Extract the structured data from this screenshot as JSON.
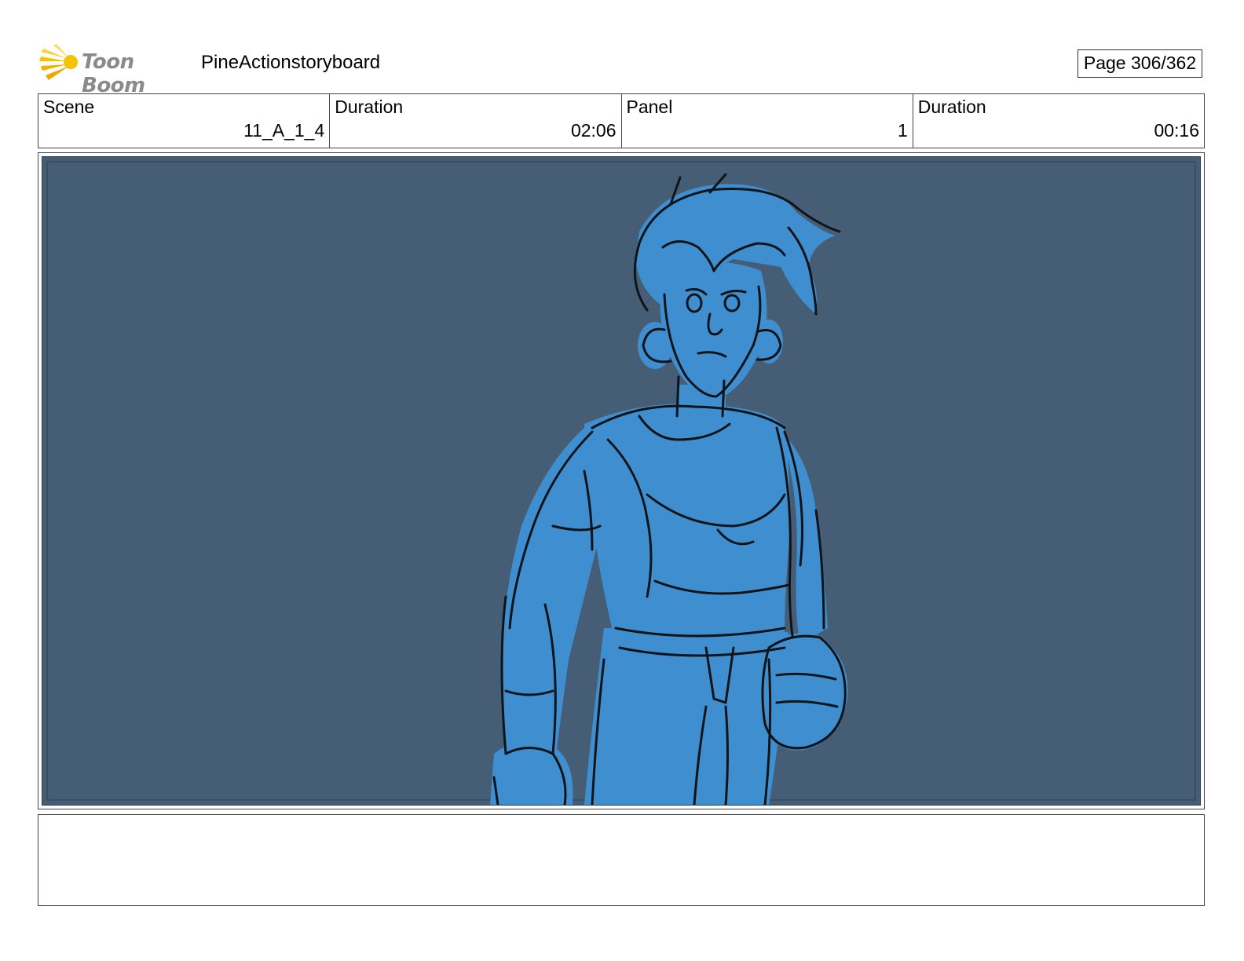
{
  "header": {
    "logo_text": "Toon Boom",
    "project_title": "PineActionstoryboard",
    "page_label": "Page 306/362"
  },
  "info": {
    "scene_label": "Scene",
    "scene_value": "11_A_1_4",
    "scene_duration_label": "Duration",
    "scene_duration_value": "02:06",
    "panel_label": "Panel",
    "panel_value": "1",
    "panel_duration_label": "Duration",
    "panel_duration_value": "00:16"
  },
  "colors": {
    "panel_background": "#455e76",
    "character_fill": "#3f8fd0",
    "logo_accent": "#f5c400"
  },
  "notes": {
    "text": ""
  }
}
